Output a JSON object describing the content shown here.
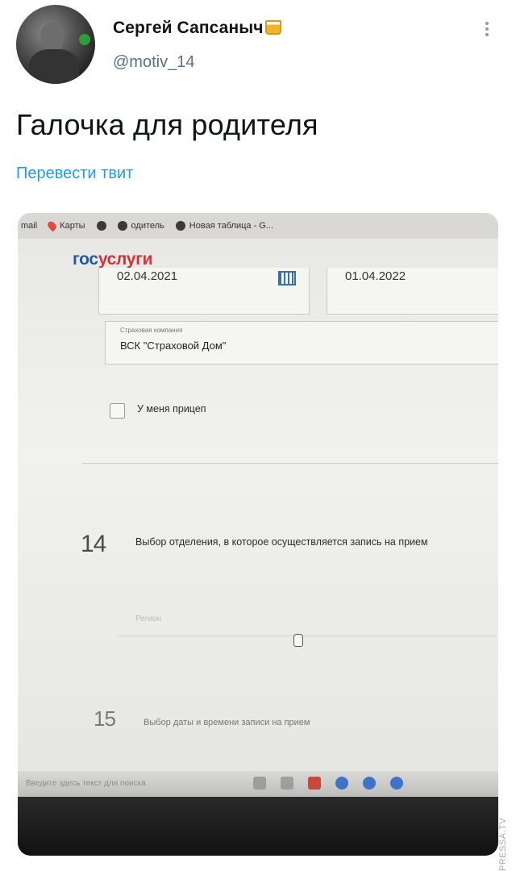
{
  "tweet": {
    "author_name": "Сергей Сапсаныч",
    "author_emoji": "beer-mug-icon",
    "handle": "@motiv_14",
    "text": "Галочка для родителя",
    "translate_label": "Перевести твит"
  },
  "photo": {
    "bookmarks": [
      {
        "icon": "mail-icon",
        "label": "mail"
      },
      {
        "icon": "maps-pin-icon",
        "label": "Карты"
      },
      {
        "icon": "globe-icon",
        "label": ""
      },
      {
        "icon": "globe-icon",
        "label": "одитель"
      },
      {
        "icon": "globe-icon",
        "label": "Новая таблица - G..."
      }
    ],
    "site_logo": {
      "part1": "гос",
      "part2": "услуги"
    },
    "dates": {
      "start": "02.04.2021",
      "end": "01.04.2022"
    },
    "insurer": {
      "label": "Страховая компания",
      "value": "ВСК \"Страховой Дом\""
    },
    "trailer_checkbox": {
      "label": "У меня прицеп",
      "checked": false
    },
    "step14": {
      "number": "14",
      "text": "Выбор отделения, в которое осуществляется запись на прием"
    },
    "region_placeholder": "Регион",
    "step15": {
      "number": "15",
      "text": "Выбор даты и времени записи на прием"
    },
    "taskbar_search": "Введите здесь текст для поиска",
    "watermark": "PRESSA.TV"
  },
  "colors": {
    "link": "#1d9bf0",
    "gos_blue": "#1d5aa8",
    "gos_red": "#d3323b"
  }
}
